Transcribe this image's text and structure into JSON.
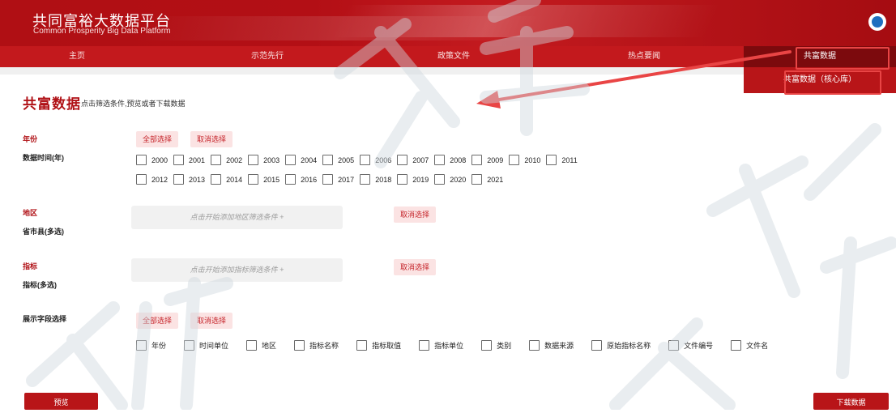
{
  "header": {
    "title": "共同富裕大数据平台",
    "subtitle": "Common Prosperity Big Data Platform",
    "logo_icon": "platform-logo"
  },
  "nav": {
    "items": [
      {
        "label": "主页"
      },
      {
        "label": "示范先行"
      },
      {
        "label": "政策文件"
      },
      {
        "label": "热点要闻"
      },
      {
        "label": "共富数据"
      }
    ],
    "active_index": 4,
    "dropdown_item": "共富数据（核心库）"
  },
  "page": {
    "title": "共富数据",
    "hint": "点击筛选条件,预览或者下载数据"
  },
  "year": {
    "section": "年份",
    "label": "数据时间(年)",
    "select_all": "全部选择",
    "cancel": "取消选择",
    "row1": [
      "2000",
      "2001",
      "2002",
      "2003",
      "2004",
      "2005",
      "2006",
      "2007",
      "2008",
      "2009",
      "2010",
      "2011"
    ],
    "row2": [
      "2012",
      "2013",
      "2014",
      "2015",
      "2016",
      "2017",
      "2018",
      "2019",
      "2020",
      "2021"
    ]
  },
  "region": {
    "section": "地区",
    "label": "省市县(多选)",
    "placeholder": "点击开始添加地区筛选条件 +",
    "cancel": "取消选择"
  },
  "indicator": {
    "section": "指标",
    "label": "指标(多选)",
    "placeholder": "点击开始添加指标筛选条件 +",
    "cancel": "取消选择"
  },
  "fields": {
    "section": "展示字段选择",
    "select_all": "全部选择",
    "cancel": "取消选择",
    "items": [
      "年份",
      "时间单位",
      "地区",
      "指标名称",
      "指标取值",
      "指标单位",
      "类别",
      "数据来源",
      "原始指标名称",
      "文件编号",
      "文件名"
    ]
  },
  "actions": {
    "preview": "预览",
    "download": "下载数据"
  },
  "colors": {
    "brand_red": "#b81518",
    "annotation_red": "#e94545"
  }
}
